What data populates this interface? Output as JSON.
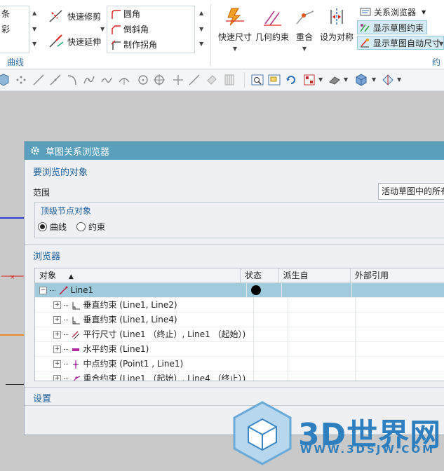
{
  "ribbon": {
    "left_partial_1": "条",
    "left_partial_2": "彩",
    "quick_trim": "快速修剪",
    "quick_extend": "快速延伸",
    "fillet": "圆角",
    "chamfer": "倒斜角",
    "make_corner": "制作拐角",
    "group_curve": "曲线",
    "rapid_dimension": "快速尺寸",
    "geometric_constraints": "几何约束",
    "coincident": "重合",
    "make_symmetric": "设为对称",
    "relations_browser": "关系浏览器",
    "show_sketch_constraints": "显示草图约束",
    "show_sketch_auto_dimensions": "显示草图自动尺寸",
    "group_constraint_partial": "约束"
  },
  "dialog": {
    "title": "草图关系浏览器",
    "objects_section": "要浏览的对象",
    "scope_label": "范围",
    "scope_value": "活动草图中的所有",
    "top_level_label": "顶级节点对象",
    "radio_curve": "曲线",
    "radio_constraint": "约束",
    "browser_section": "浏览器",
    "columns": {
      "object": "对象",
      "status": "状态",
      "derived_from": "派生自",
      "external_ref": "外部引用"
    },
    "tree": {
      "root": "Line1",
      "children": [
        "垂直约束 (Line1, Line2)",
        "垂直约束 (Line1, Line4)",
        "平行尺寸 (Line1 （终止）, Line1 （起始）)",
        "水平约束 (Line1)",
        "中点约束 (Point1 , Line1)",
        "重合约束 (Line1 （起始）, Line4 （终止）)"
      ]
    },
    "settings_section": "设置"
  },
  "watermark": {
    "brand": "3D世界网",
    "url": "WWW.3DSJW.COM"
  },
  "colors": {
    "dialog_title_bar": "#5a9fbb",
    "selected_row": "#9fcbdc",
    "section_title": "#1e5f9b",
    "watermark": "#2d7fbf"
  }
}
